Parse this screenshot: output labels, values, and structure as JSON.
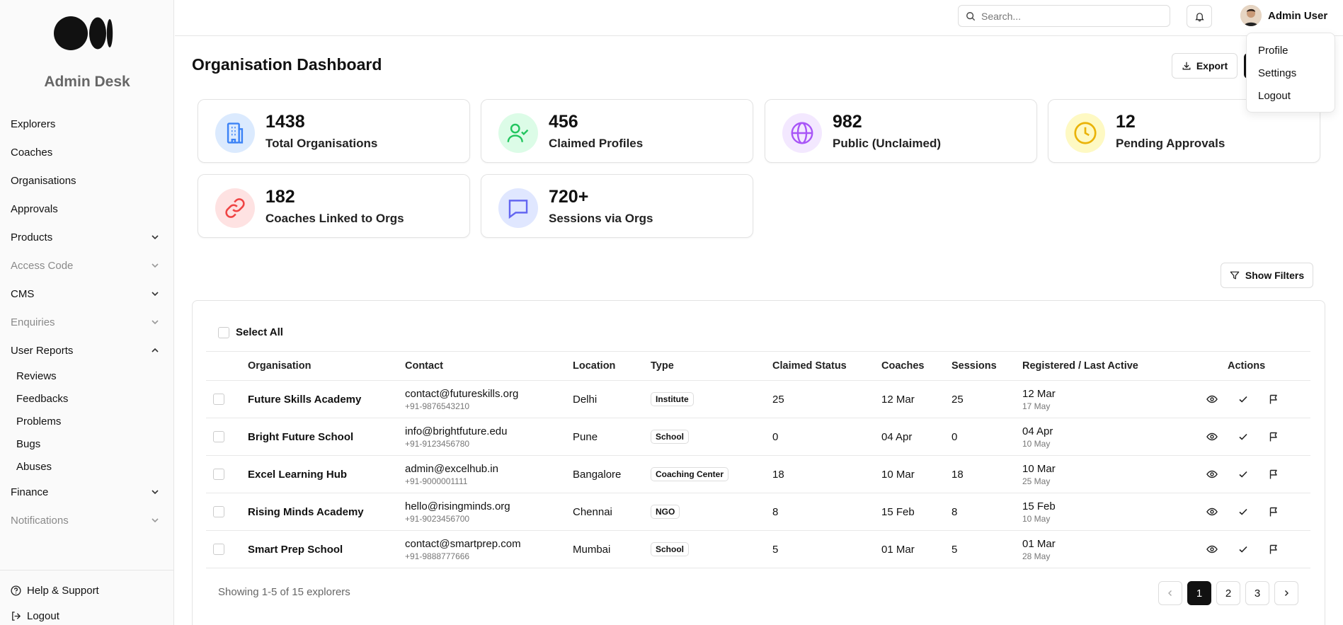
{
  "sidebar": {
    "brand": "Admin Desk",
    "items": [
      {
        "label": "Explorers"
      },
      {
        "label": "Coaches"
      },
      {
        "label": "Organisations"
      },
      {
        "label": "Approvals"
      },
      {
        "label": "Products"
      },
      {
        "label": "Access Code"
      },
      {
        "label": "CMS"
      },
      {
        "label": "Enquiries"
      },
      {
        "label": "User Reports"
      },
      {
        "label": "Finance"
      },
      {
        "label": "Notifications"
      }
    ],
    "user_reports_sub": [
      {
        "label": "Reviews"
      },
      {
        "label": "Feedbacks"
      },
      {
        "label": "Problems"
      },
      {
        "label": "Bugs"
      },
      {
        "label": "Abuses"
      }
    ],
    "help_label": "Help & Support",
    "logout_label": "Logout"
  },
  "topbar": {
    "search_placeholder": "Search...",
    "user_name": "Admin User"
  },
  "user_menu": [
    "Profile",
    "Settings",
    "Logout"
  ],
  "page": {
    "title": "Organisation Dashboard",
    "export_label": "Export",
    "show_filters_label": "Show Filters",
    "select_all_label": "Select All"
  },
  "stats": [
    {
      "value": "1438",
      "label": "Total Organisations",
      "color": "#3b82f6",
      "bg": "#dbeafe",
      "icon": "building-icon"
    },
    {
      "value": "456",
      "label": "Claimed Profiles",
      "color": "#22c55e",
      "bg": "#dcfce7",
      "icon": "user-check-icon"
    },
    {
      "value": "982",
      "label": "Public (Unclaimed)",
      "color": "#a855f7",
      "bg": "#f3e8ff",
      "icon": "globe-icon"
    },
    {
      "value": "12",
      "label": "Pending Approvals",
      "color": "#eab308",
      "bg": "#fef9c3",
      "icon": "clock-icon"
    },
    {
      "value": "182",
      "label": "Coaches Linked to Orgs",
      "color": "#ef4444",
      "bg": "#fee2e2",
      "icon": "link-icon"
    },
    {
      "value": "720+",
      "label": "Sessions via Orgs",
      "color": "#6366f1",
      "bg": "#e0e7ff",
      "icon": "message-icon"
    }
  ],
  "table": {
    "headers": {
      "organisation": "Organisation",
      "contact": "Contact",
      "location": "Location",
      "type": "Type",
      "claimed": "Claimed Status",
      "coaches": "Coaches",
      "sessions": "Sessions",
      "registered": "Registered / Last Active",
      "actions": "Actions"
    },
    "rows": [
      {
        "org": "Future Skills Academy",
        "email": "contact@futureskills.org",
        "phone": "+91-9876543210",
        "location": "Delhi",
        "type": "Institute",
        "claimed": "25",
        "coaches": "12 Mar",
        "sessions": "25",
        "registered": "12 Mar",
        "last": "17 May"
      },
      {
        "org": "Bright Future School",
        "email": "info@brightfuture.edu",
        "phone": "+91-9123456780",
        "location": "Pune",
        "type": "School",
        "claimed": "0",
        "coaches": "04 Apr",
        "sessions": "0",
        "registered": "04 Apr",
        "last": "10 May"
      },
      {
        "org": "Excel Learning Hub",
        "email": "admin@excelhub.in",
        "phone": "+91-9000001111",
        "location": "Bangalore",
        "type": "Coaching Center",
        "claimed": "18",
        "coaches": "10 Mar",
        "sessions": "18",
        "registered": "10 Mar",
        "last": "25 May"
      },
      {
        "org": "Rising Minds Academy",
        "email": "hello@risingminds.org",
        "phone": "+91-9023456700",
        "location": "Chennai",
        "type": "NGO",
        "claimed": "8",
        "coaches": "15 Feb",
        "sessions": "8",
        "registered": "15 Feb",
        "last": "10 May"
      },
      {
        "org": "Smart Prep School",
        "email": "contact@smartprep.com",
        "phone": "+91-9888777666",
        "location": "Mumbai",
        "type": "School",
        "claimed": "5",
        "coaches": "01 Mar",
        "sessions": "5",
        "registered": "01 Mar",
        "last": "28 May"
      }
    ]
  },
  "pagination": {
    "showing": "Showing 1-5 of 15 explorers",
    "pages": [
      "1",
      "2",
      "3"
    ],
    "current": "1"
  }
}
